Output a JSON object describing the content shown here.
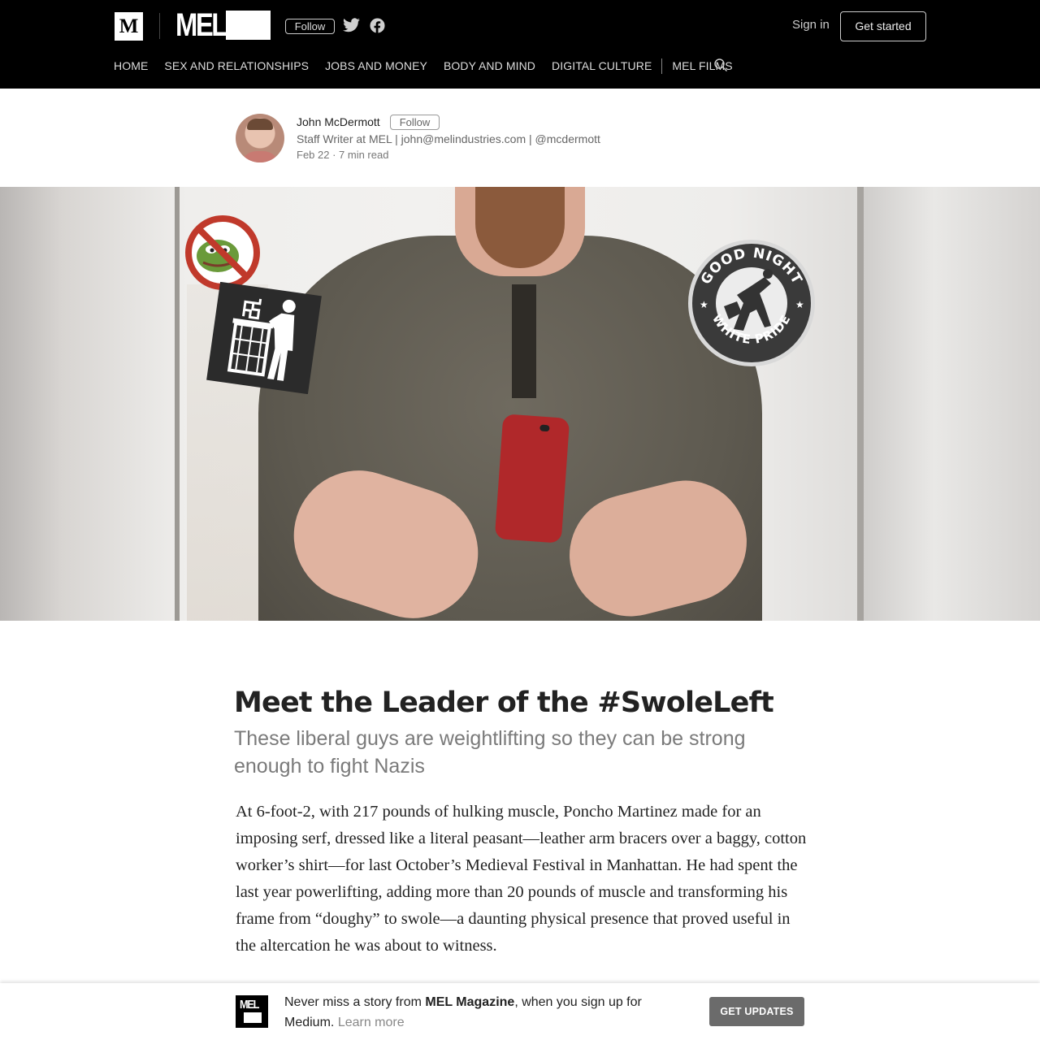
{
  "header": {
    "medium_logo": "M",
    "publication_logo": "MEL",
    "follow_label": "Follow",
    "sign_in_label": "Sign in",
    "get_started_label": "Get started",
    "icons": [
      "twitter-icon",
      "facebook-icon",
      "search-icon"
    ]
  },
  "nav": {
    "items": [
      {
        "label": "HOME"
      },
      {
        "label": "SEX AND RELATIONSHIPS"
      },
      {
        "label": "JOBS AND MONEY"
      },
      {
        "label": "BODY AND MIND"
      },
      {
        "label": "DIGITAL CULTURE"
      },
      {
        "label": "MEL FILMS"
      }
    ]
  },
  "author": {
    "name": "John McDermott",
    "follow_label": "Follow",
    "bio": "Staff Writer at MEL | john@melindustries.com | @mcdermott",
    "meta": "Feb 22 · 7 min read"
  },
  "hero": {
    "stickers": {
      "goodnight_top": "GOOD NIGHT",
      "goodnight_bottom": "WHITE PRIDE"
    }
  },
  "article": {
    "title": "Meet the Leader of the #SwoleLeft",
    "subtitle": "These liberal guys are weightlifting so they can be strong enough to fight Nazis",
    "body": "At 6-foot-2, with 217 pounds of hulking muscle, Poncho Martinez made for an imposing serf, dressed like a literal peasant—leather arm bracers over a baggy, cotton worker’s shirt—for last October’s Medieval Festival in Manhattan. He had spent the last year powerlifting, adding more than 20 pounds of muscle and transforming his frame from “doughy” to swole—a daunting physical presence that proved useful in the altercation he was about to witness."
  },
  "banner": {
    "logo_text": "MEL",
    "text_prefix": "Never miss a story from ",
    "publication": "MEL Magazine",
    "text_suffix": ", when you sign up for Medium.",
    "learn_more": "Learn more",
    "button_label": "GET UPDATES"
  },
  "colors": {
    "header_bg": "#000000",
    "button_gray": "#6b6b6b",
    "subtitle_gray": "#7a7a7a"
  }
}
